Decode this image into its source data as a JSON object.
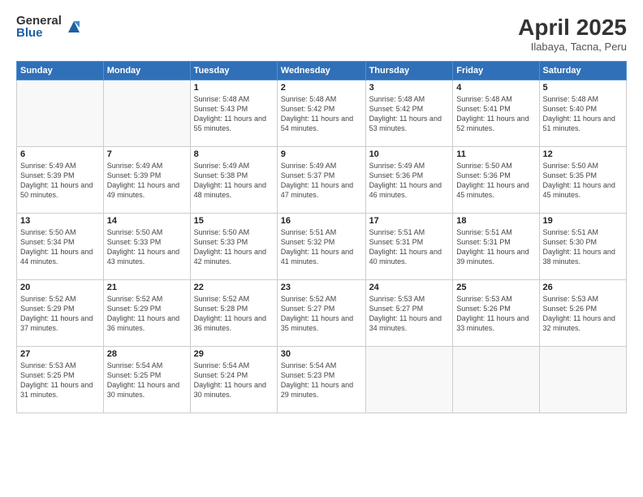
{
  "header": {
    "logo_general": "General",
    "logo_blue": "Blue",
    "title": "April 2025",
    "location": "Ilabaya, Tacna, Peru"
  },
  "weekdays": [
    "Sunday",
    "Monday",
    "Tuesday",
    "Wednesday",
    "Thursday",
    "Friday",
    "Saturday"
  ],
  "weeks": [
    [
      {
        "day": "",
        "info": ""
      },
      {
        "day": "",
        "info": ""
      },
      {
        "day": "1",
        "info": "Sunrise: 5:48 AM\nSunset: 5:43 PM\nDaylight: 11 hours and 55 minutes."
      },
      {
        "day": "2",
        "info": "Sunrise: 5:48 AM\nSunset: 5:42 PM\nDaylight: 11 hours and 54 minutes."
      },
      {
        "day": "3",
        "info": "Sunrise: 5:48 AM\nSunset: 5:42 PM\nDaylight: 11 hours and 53 minutes."
      },
      {
        "day": "4",
        "info": "Sunrise: 5:48 AM\nSunset: 5:41 PM\nDaylight: 11 hours and 52 minutes."
      },
      {
        "day": "5",
        "info": "Sunrise: 5:48 AM\nSunset: 5:40 PM\nDaylight: 11 hours and 51 minutes."
      }
    ],
    [
      {
        "day": "6",
        "info": "Sunrise: 5:49 AM\nSunset: 5:39 PM\nDaylight: 11 hours and 50 minutes."
      },
      {
        "day": "7",
        "info": "Sunrise: 5:49 AM\nSunset: 5:39 PM\nDaylight: 11 hours and 49 minutes."
      },
      {
        "day": "8",
        "info": "Sunrise: 5:49 AM\nSunset: 5:38 PM\nDaylight: 11 hours and 48 minutes."
      },
      {
        "day": "9",
        "info": "Sunrise: 5:49 AM\nSunset: 5:37 PM\nDaylight: 11 hours and 47 minutes."
      },
      {
        "day": "10",
        "info": "Sunrise: 5:49 AM\nSunset: 5:36 PM\nDaylight: 11 hours and 46 minutes."
      },
      {
        "day": "11",
        "info": "Sunrise: 5:50 AM\nSunset: 5:36 PM\nDaylight: 11 hours and 45 minutes."
      },
      {
        "day": "12",
        "info": "Sunrise: 5:50 AM\nSunset: 5:35 PM\nDaylight: 11 hours and 45 minutes."
      }
    ],
    [
      {
        "day": "13",
        "info": "Sunrise: 5:50 AM\nSunset: 5:34 PM\nDaylight: 11 hours and 44 minutes."
      },
      {
        "day": "14",
        "info": "Sunrise: 5:50 AM\nSunset: 5:33 PM\nDaylight: 11 hours and 43 minutes."
      },
      {
        "day": "15",
        "info": "Sunrise: 5:50 AM\nSunset: 5:33 PM\nDaylight: 11 hours and 42 minutes."
      },
      {
        "day": "16",
        "info": "Sunrise: 5:51 AM\nSunset: 5:32 PM\nDaylight: 11 hours and 41 minutes."
      },
      {
        "day": "17",
        "info": "Sunrise: 5:51 AM\nSunset: 5:31 PM\nDaylight: 11 hours and 40 minutes."
      },
      {
        "day": "18",
        "info": "Sunrise: 5:51 AM\nSunset: 5:31 PM\nDaylight: 11 hours and 39 minutes."
      },
      {
        "day": "19",
        "info": "Sunrise: 5:51 AM\nSunset: 5:30 PM\nDaylight: 11 hours and 38 minutes."
      }
    ],
    [
      {
        "day": "20",
        "info": "Sunrise: 5:52 AM\nSunset: 5:29 PM\nDaylight: 11 hours and 37 minutes."
      },
      {
        "day": "21",
        "info": "Sunrise: 5:52 AM\nSunset: 5:29 PM\nDaylight: 11 hours and 36 minutes."
      },
      {
        "day": "22",
        "info": "Sunrise: 5:52 AM\nSunset: 5:28 PM\nDaylight: 11 hours and 36 minutes."
      },
      {
        "day": "23",
        "info": "Sunrise: 5:52 AM\nSunset: 5:27 PM\nDaylight: 11 hours and 35 minutes."
      },
      {
        "day": "24",
        "info": "Sunrise: 5:53 AM\nSunset: 5:27 PM\nDaylight: 11 hours and 34 minutes."
      },
      {
        "day": "25",
        "info": "Sunrise: 5:53 AM\nSunset: 5:26 PM\nDaylight: 11 hours and 33 minutes."
      },
      {
        "day": "26",
        "info": "Sunrise: 5:53 AM\nSunset: 5:26 PM\nDaylight: 11 hours and 32 minutes."
      }
    ],
    [
      {
        "day": "27",
        "info": "Sunrise: 5:53 AM\nSunset: 5:25 PM\nDaylight: 11 hours and 31 minutes."
      },
      {
        "day": "28",
        "info": "Sunrise: 5:54 AM\nSunset: 5:25 PM\nDaylight: 11 hours and 30 minutes."
      },
      {
        "day": "29",
        "info": "Sunrise: 5:54 AM\nSunset: 5:24 PM\nDaylight: 11 hours and 30 minutes."
      },
      {
        "day": "30",
        "info": "Sunrise: 5:54 AM\nSunset: 5:23 PM\nDaylight: 11 hours and 29 minutes."
      },
      {
        "day": "",
        "info": ""
      },
      {
        "day": "",
        "info": ""
      },
      {
        "day": "",
        "info": ""
      }
    ]
  ]
}
